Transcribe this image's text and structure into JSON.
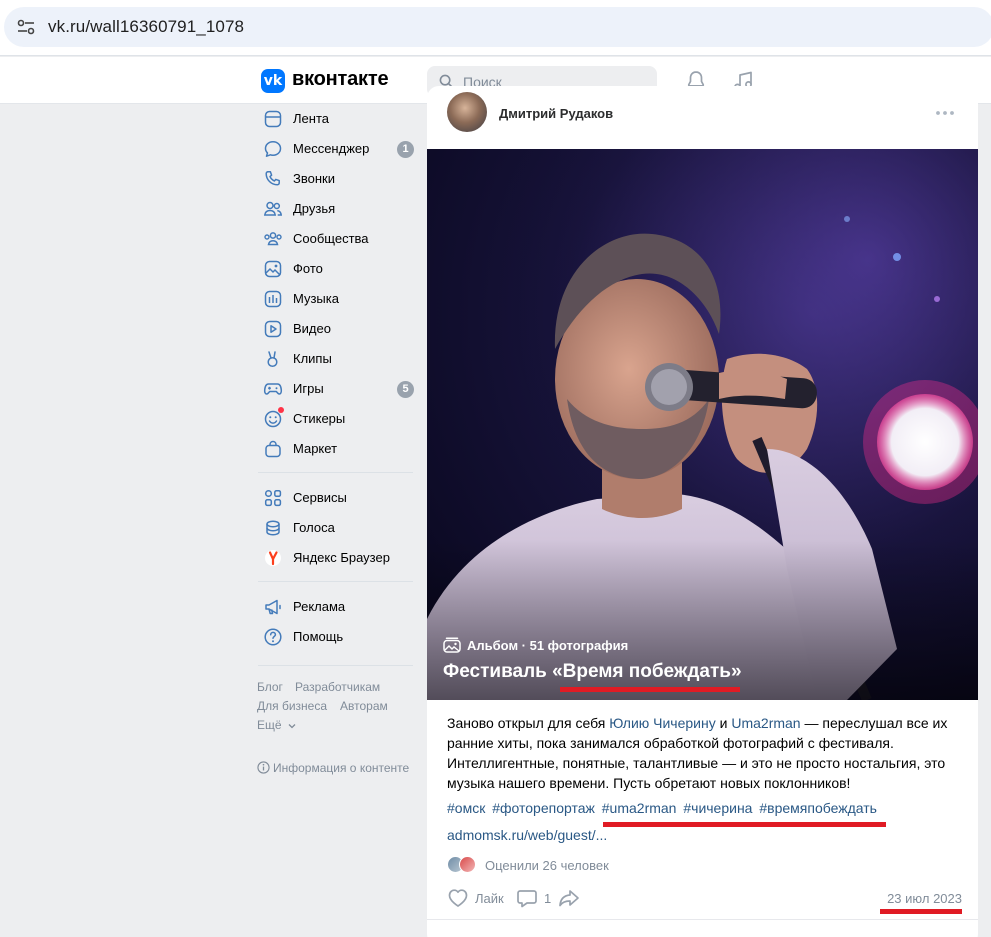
{
  "browser": {
    "url": "vk.ru/wall16360791_1078"
  },
  "header": {
    "logo_letter": "vk",
    "wordmark": "вконтакте",
    "search_placeholder": "Поиск",
    "brand_color": "#0077ff"
  },
  "nav": {
    "items": [
      {
        "label": "Лента",
        "icon": "feed-icon"
      },
      {
        "label": "Мессенджер",
        "icon": "messenger-icon",
        "badge": "1"
      },
      {
        "label": "Звонки",
        "icon": "phone-icon"
      },
      {
        "label": "Друзья",
        "icon": "friends-icon"
      },
      {
        "label": "Сообщества",
        "icon": "communities-icon"
      },
      {
        "label": "Фото",
        "icon": "photo-icon"
      },
      {
        "label": "Музыка",
        "icon": "music-icon"
      },
      {
        "label": "Видео",
        "icon": "video-icon"
      },
      {
        "label": "Клипы",
        "icon": "clips-icon"
      },
      {
        "label": "Игры",
        "icon": "games-icon",
        "badge": "5"
      },
      {
        "label": "Стикеры",
        "icon": "stickers-icon"
      },
      {
        "label": "Маркет",
        "icon": "market-icon"
      }
    ],
    "items2": [
      {
        "label": "Сервисы",
        "icon": "services-icon"
      },
      {
        "label": "Голоса",
        "icon": "votes-icon"
      },
      {
        "label": "Яндекс Браузер",
        "icon": "yandex-browser-icon"
      }
    ],
    "items3": [
      {
        "label": "Реклама",
        "icon": "ads-icon"
      },
      {
        "label": "Помощь",
        "icon": "help-icon"
      }
    ],
    "footer": {
      "blog": "Блог",
      "developers": "Разработчикам",
      "business": "Для бизнеса",
      "authors": "Авторам",
      "more": "Ещё",
      "content_info": "Информация о контенте"
    }
  },
  "post": {
    "author": "Дмитрий Рудаков",
    "album_label": "Альбом · 51 фотография",
    "album_title": "Фестиваль «Время побеждать»",
    "text": {
      "part1": "Заново открыл для себя ",
      "link1": "Юлию Чичерину",
      "part2": " и ",
      "link2": "Uma2rman",
      "part3": " — переслушал все их ранние хиты, пока занимался обработкой фотографий с фестиваля. Интеллигентные, понятные, талантливые — и это не просто ностальгия, это музыка нашего времени. Пусть обретают новых поклонников!"
    },
    "hashtags": [
      "#омск",
      "#фоторепортаж",
      "#uma2rman",
      "#чичерина",
      "#времяпобеждать"
    ],
    "external_link": "admomsk.ru/web/guest/...",
    "rated": "Оценили 26 человек",
    "like_label": "Лайк",
    "comments_count": "1",
    "date": "23 июл 2023"
  },
  "annotation_color": "#e01b24"
}
